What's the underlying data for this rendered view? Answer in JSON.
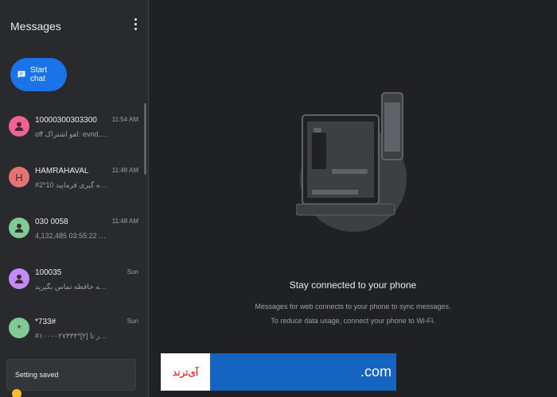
{
  "sidebar": {
    "title": "Messages",
    "start_chat_label": "Start chat",
    "conversations": [
      {
        "name": "10000300303300",
        "snippet": "off لغو اشتراک: evnd.co/Rj...",
        "time": "11:54 AM",
        "avatar_color": "#f06292",
        "avatar_glyph": "person-icon"
      },
      {
        "name": "HAMRAHAVAL",
        "snippet": "#2*10 را شماره گیری فرمایید...",
        "time": "11:48 AM",
        "avatar_color": "#e57373",
        "avatar_letter": "H"
      },
      {
        "name": "030 0058",
        "snippet": "4,132,485 مانده 03:55:22...",
        "time": "11:48 AM",
        "avatar_color": "#81c995",
        "avatar_glyph": "person-icon"
      },
      {
        "name": "100035",
        "snippet": "با سلامت ضمیمه حافظه تماس بگیرید...",
        "time": "Sun",
        "avatar_color": "#c58af9",
        "avatar_glyph": "person-icon"
      },
      {
        "name": "*733#",
        "snippet": "#۱۰۰۰۰۲۷۳۳۴*[۲] ساعت بیگیار تا...",
        "time": "Sun",
        "avatar_color": "#81c995",
        "avatar_letter": "*"
      }
    ]
  },
  "toast": {
    "text": "Setting saved"
  },
  "main": {
    "headline": "Stay connected to your phone",
    "line1": "Messages for web connects to your phone to sync messages.",
    "line2": "To reduce data usage, connect your phone to Wi-Fi."
  },
  "watermark": {
    "left_text": "آی‌ترند",
    "right_text": ".com"
  },
  "colors": {
    "background": "#202124",
    "sidebar": "#292a2d",
    "accent": "#1a73e8"
  }
}
